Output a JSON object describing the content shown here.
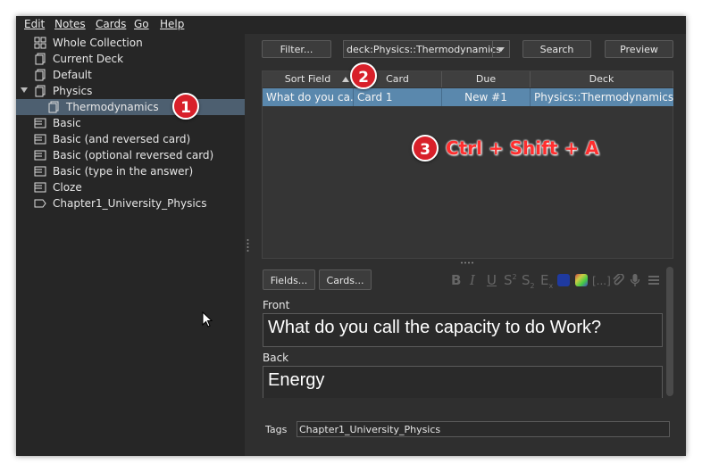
{
  "menu": [
    "Edit",
    "Notes",
    "Cards",
    "Go",
    "Help"
  ],
  "sidebar": {
    "items": [
      {
        "label": "Whole Collection",
        "icon": "collection-icon"
      },
      {
        "label": "Current Deck",
        "icon": "deck-icon"
      },
      {
        "label": "Default",
        "icon": "deck-icon"
      },
      {
        "label": "Physics",
        "icon": "deck-icon",
        "expanded": true
      },
      {
        "label": "Thermodynamics",
        "icon": "deck-icon",
        "selected": true
      },
      {
        "label": "Basic",
        "icon": "note-type-icon"
      },
      {
        "label": "Basic (and reversed card)",
        "icon": "note-type-icon"
      },
      {
        "label": "Basic (optional reversed card)",
        "icon": "note-type-icon"
      },
      {
        "label": "Basic (type in the answer)",
        "icon": "note-type-icon"
      },
      {
        "label": "Cloze",
        "icon": "note-type-icon"
      },
      {
        "label": "Chapter1_University_Physics",
        "icon": "tag-icon"
      }
    ]
  },
  "toolbar": {
    "filter_label": "Filter...",
    "search_query": "deck:Physics::Thermodynamics",
    "search_label": "Search",
    "preview_label": "Preview"
  },
  "table": {
    "columns": [
      "Sort Field",
      "Card",
      "Due",
      "Deck"
    ],
    "rows": [
      {
        "sort_field": "What do you ca...",
        "card": "Card 1",
        "due": "New #1",
        "deck": "Physics::Thermodynamics"
      }
    ]
  },
  "editor": {
    "fields_label": "Fields...",
    "cards_label": "Cards...",
    "format_icons": [
      "bold-icon",
      "italic-icon",
      "underline-icon",
      "superscript-icon",
      "subscript-icon",
      "clear-format-icon",
      "text-color-icon",
      "highlight-color-icon",
      "cloze-icon",
      "attach-icon",
      "record-icon",
      "more-icon"
    ],
    "fields": [
      {
        "label": "Front",
        "value": "What do you call the capacity to do Work?"
      },
      {
        "label": "Back",
        "value": "Energy"
      }
    ],
    "tags_label": "Tags",
    "tags_value": "Chapter1_University_Physics"
  },
  "annotations": {
    "badge1": "1",
    "badge2": "2",
    "badge3": "3",
    "shortcut": "Ctrl + Shift + A"
  },
  "colors": {
    "selection": "#5a88ad",
    "sidebar_selection": "#4d5f70",
    "badge": "#d8202a",
    "shortcut_text": "#ff2e2e",
    "text_color_swatch": "#1f3aa0"
  }
}
